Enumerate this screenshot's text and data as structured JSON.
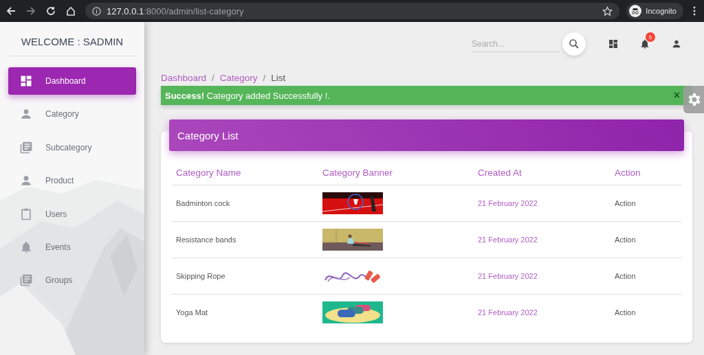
{
  "browser": {
    "url_host": "127.0.0.1",
    "url_path": ":8000/admin/list-category",
    "profile": "Incognito"
  },
  "sidebar": {
    "welcome": "WELCOME : SADMIN",
    "items": [
      {
        "label": "Dashboard",
        "kind": "dashboard",
        "selected": true
      },
      {
        "label": "Category",
        "kind": "person",
        "selected": false
      },
      {
        "label": "Subcategory",
        "kind": "list",
        "selected": false
      },
      {
        "label": "Product",
        "kind": "person",
        "selected": false
      },
      {
        "label": "Users",
        "kind": "clipboard",
        "selected": false
      },
      {
        "label": "Events",
        "kind": "bell",
        "selected": false
      },
      {
        "label": "Groups",
        "kind": "list",
        "selected": false
      }
    ]
  },
  "topbar": {
    "search": {
      "placeholder": "Search..."
    },
    "notifications_badge": "5"
  },
  "breadcrumb_separator": "/",
  "breadcrumb": [
    {
      "label": "Dashboard",
      "kind": "link"
    },
    {
      "label": "Category",
      "kind": "link"
    },
    {
      "label": "List",
      "kind": "current"
    }
  ],
  "alert": {
    "text": "**Success!** Category added Successfully !.",
    "close": "×"
  },
  "card": {
    "title": "Category List",
    "columns": [
      "Category Name",
      "Category Banner",
      "Created At",
      "Action"
    ],
    "rows": [
      {
        "name": "Badminton cock",
        "created": "21 February 2022",
        "action": "Action"
      },
      {
        "name": "Resistance bands",
        "created": "21 February 2022",
        "action": "Action"
      },
      {
        "name": "Skipping Rope",
        "created": "21 February 2022",
        "action": "Action"
      },
      {
        "name": "Yoga Mat",
        "created": "21 February 2022",
        "action": "Action"
      }
    ]
  }
}
